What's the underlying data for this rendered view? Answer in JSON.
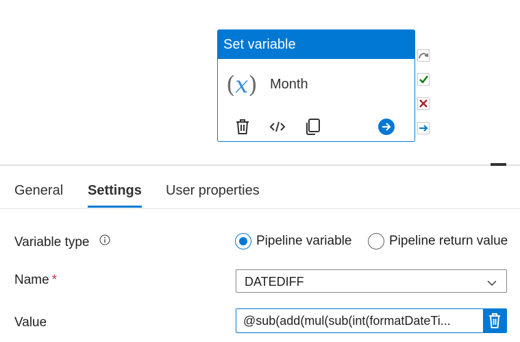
{
  "activity": {
    "type_label": "Set variable",
    "icon": "variable-x-icon",
    "icon_open": "(",
    "icon_x": "x",
    "icon_close": ")",
    "name": "Month",
    "tools": [
      "delete-icon",
      "code-icon",
      "copy-icon",
      "go-arrow-icon"
    ]
  },
  "side_connectors": [
    "skip-arrow-icon",
    "success-check-icon",
    "failure-x-icon",
    "completion-arrow-icon"
  ],
  "tabs": [
    {
      "label": "General",
      "active": false
    },
    {
      "label": "Settings",
      "active": true
    },
    {
      "label": "User properties",
      "active": false
    }
  ],
  "settings": {
    "variable_type_label": "Variable type",
    "radio_options": [
      {
        "label": "Pipeline variable",
        "checked": true
      },
      {
        "label": "Pipeline return value",
        "checked": false
      }
    ],
    "name_label": "Name",
    "required_marker": "*",
    "name_value": "DATEDIFF",
    "value_label": "Value",
    "value_text": "@sub(add(mul(sub(int(formatDateTi..."
  },
  "colors": {
    "accent": "#0078d4",
    "success": "#107c10",
    "failure": "#a4262c",
    "required": "#c4314b"
  }
}
